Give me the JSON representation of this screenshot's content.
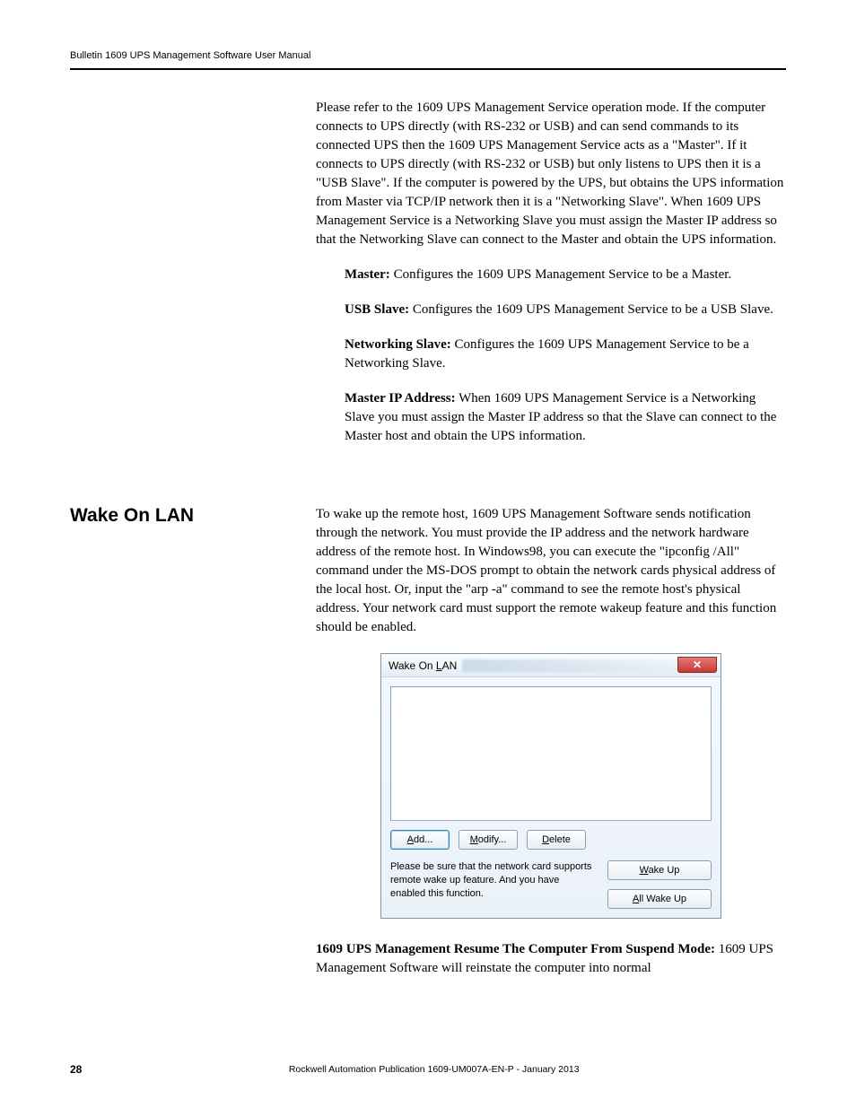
{
  "header": "Bulletin 1609 UPS Management Software User Manual",
  "intro_para": "Please refer to the 1609 UPS Management Service operation mode. If the computer connects to UPS directly (with RS-232 or USB) and can send commands to its connected UPS then the 1609 UPS Management Service acts as a \"Master\". If it connects to UPS directly (with RS-232 or USB) but only listens to UPS then it is a \"USB Slave\". If the computer is powered by the UPS, but obtains the UPS information from Master via TCP/IP network then it is a \"Networking Slave\". When 1609 UPS Management Service is a Networking Slave you must assign the Master IP address so that the Networking Slave can connect to the Master and obtain the UPS information.",
  "defs": {
    "master_term": "Master:",
    "master_text": " Configures the 1609 UPS Management Service to be a Master.",
    "usbslave_term": "USB Slave:",
    "usbslave_text": " Configures the 1609 UPS Management Service to be a USB Slave.",
    "netslave_term": "Networking Slave:",
    "netslave_text": " Configures the 1609 UPS Management Service to be a Networking Slave.",
    "masterip_term": "Master IP Address:",
    "masterip_text": " When 1609 UPS Management Service is a Networking Slave you must assign the Master IP address so that the Slave can connect to the Master host and obtain the UPS information."
  },
  "section_heading": "Wake On LAN",
  "wol_para": "To wake up the remote host, 1609 UPS Management Software sends notification through the network. You must provide the IP address and the network hardware address of the remote host. In Windows98, you can execute the \"ipconfig /All\" command under the MS-DOS prompt to obtain the network cards physical address of the local host. Or, input the \"arp -a\" command to see the remote host's physical address. Your network card must support the remote wakeup feature and this function should be enabled.",
  "dialog": {
    "title_prefix": "Wake On ",
    "title_accel": "L",
    "title_suffix": "AN",
    "add_accel": "A",
    "add_suffix": "dd...",
    "modify_accel": "M",
    "modify_suffix": "odify...",
    "delete_accel": "D",
    "delete_suffix": "elete",
    "note": "Please be sure that the network card supports remote wake up feature. And you have enabled this function.",
    "wakeup_accel": "W",
    "wakeup_suffix": "ake Up",
    "allwakeup_prefix": "",
    "allwakeup_accel": "A",
    "allwakeup_suffix": "ll Wake Up",
    "close": "✕"
  },
  "after_fig_term": "1609 UPS Management Resume The Computer From Suspend Mode:",
  "after_fig_text": " 1609 UPS Management Software will reinstate the computer into normal",
  "footer_page": "28",
  "footer_pub": "Rockwell Automation Publication 1609-UM007A-EN-P - January 2013"
}
